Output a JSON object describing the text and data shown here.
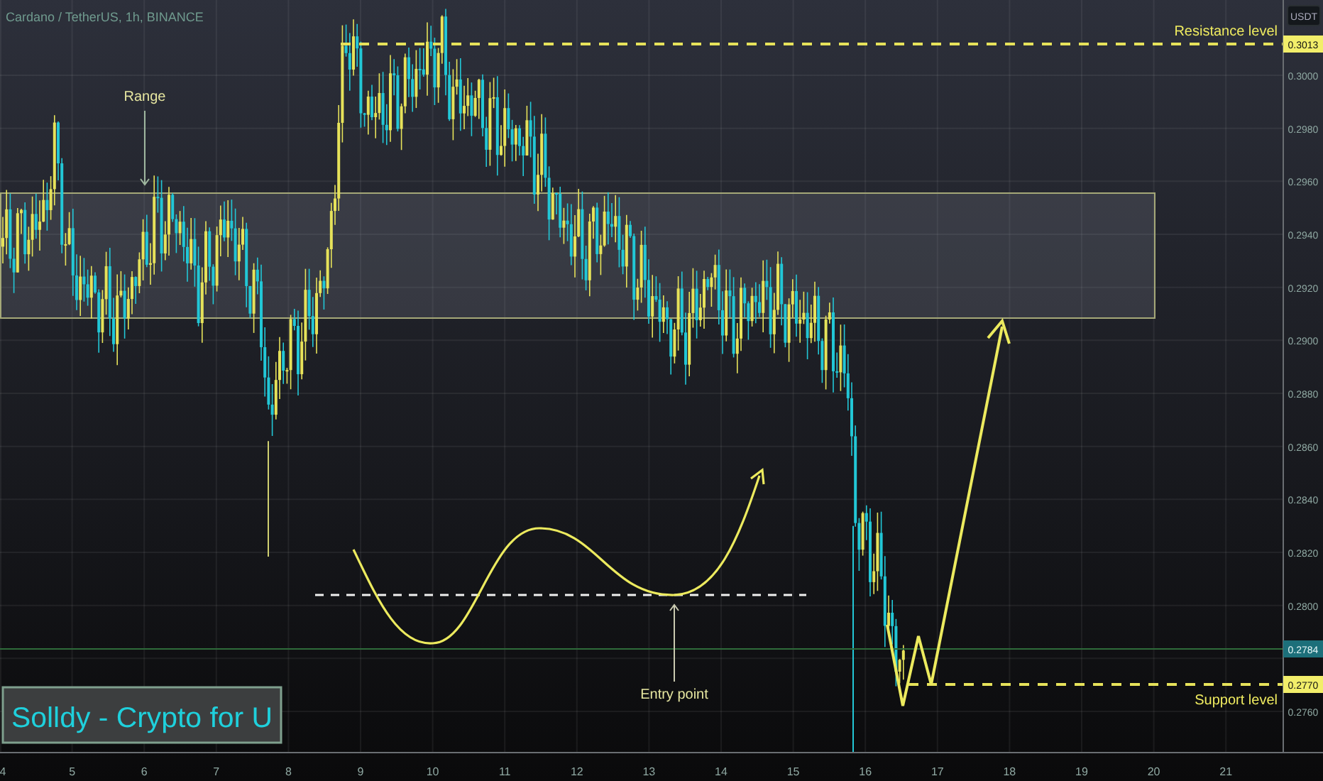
{
  "header": {
    "title": "Cardano / TetherUS, 1h, BINANCE"
  },
  "price_axis": {
    "unit": "USDT",
    "ticks": [
      "0.3000",
      "0.2980",
      "0.2960",
      "0.2940",
      "0.2920",
      "0.2900",
      "0.2880",
      "0.2860",
      "0.2840",
      "0.2820",
      "0.2800"
    ],
    "lower_ticks": [
      "0.2760"
    ],
    "badges": [
      {
        "kind": "resistance",
        "text": "0.3013"
      },
      {
        "kind": "last",
        "text": "0.2784"
      },
      {
        "kind": "support",
        "text": "0.2770"
      }
    ]
  },
  "time_axis": {
    "labels": [
      "4",
      "5",
      "6",
      "7",
      "8",
      "9",
      "10",
      "11",
      "12",
      "13",
      "14",
      "15",
      "16",
      "17",
      "18",
      "19",
      "20",
      "21"
    ]
  },
  "drawings": {
    "range_label": "Range",
    "resistance_label": "Resistance level",
    "support_label": "Support level",
    "entry_label": "Entry point",
    "signature": "Solldy - Crypto for U"
  }
}
